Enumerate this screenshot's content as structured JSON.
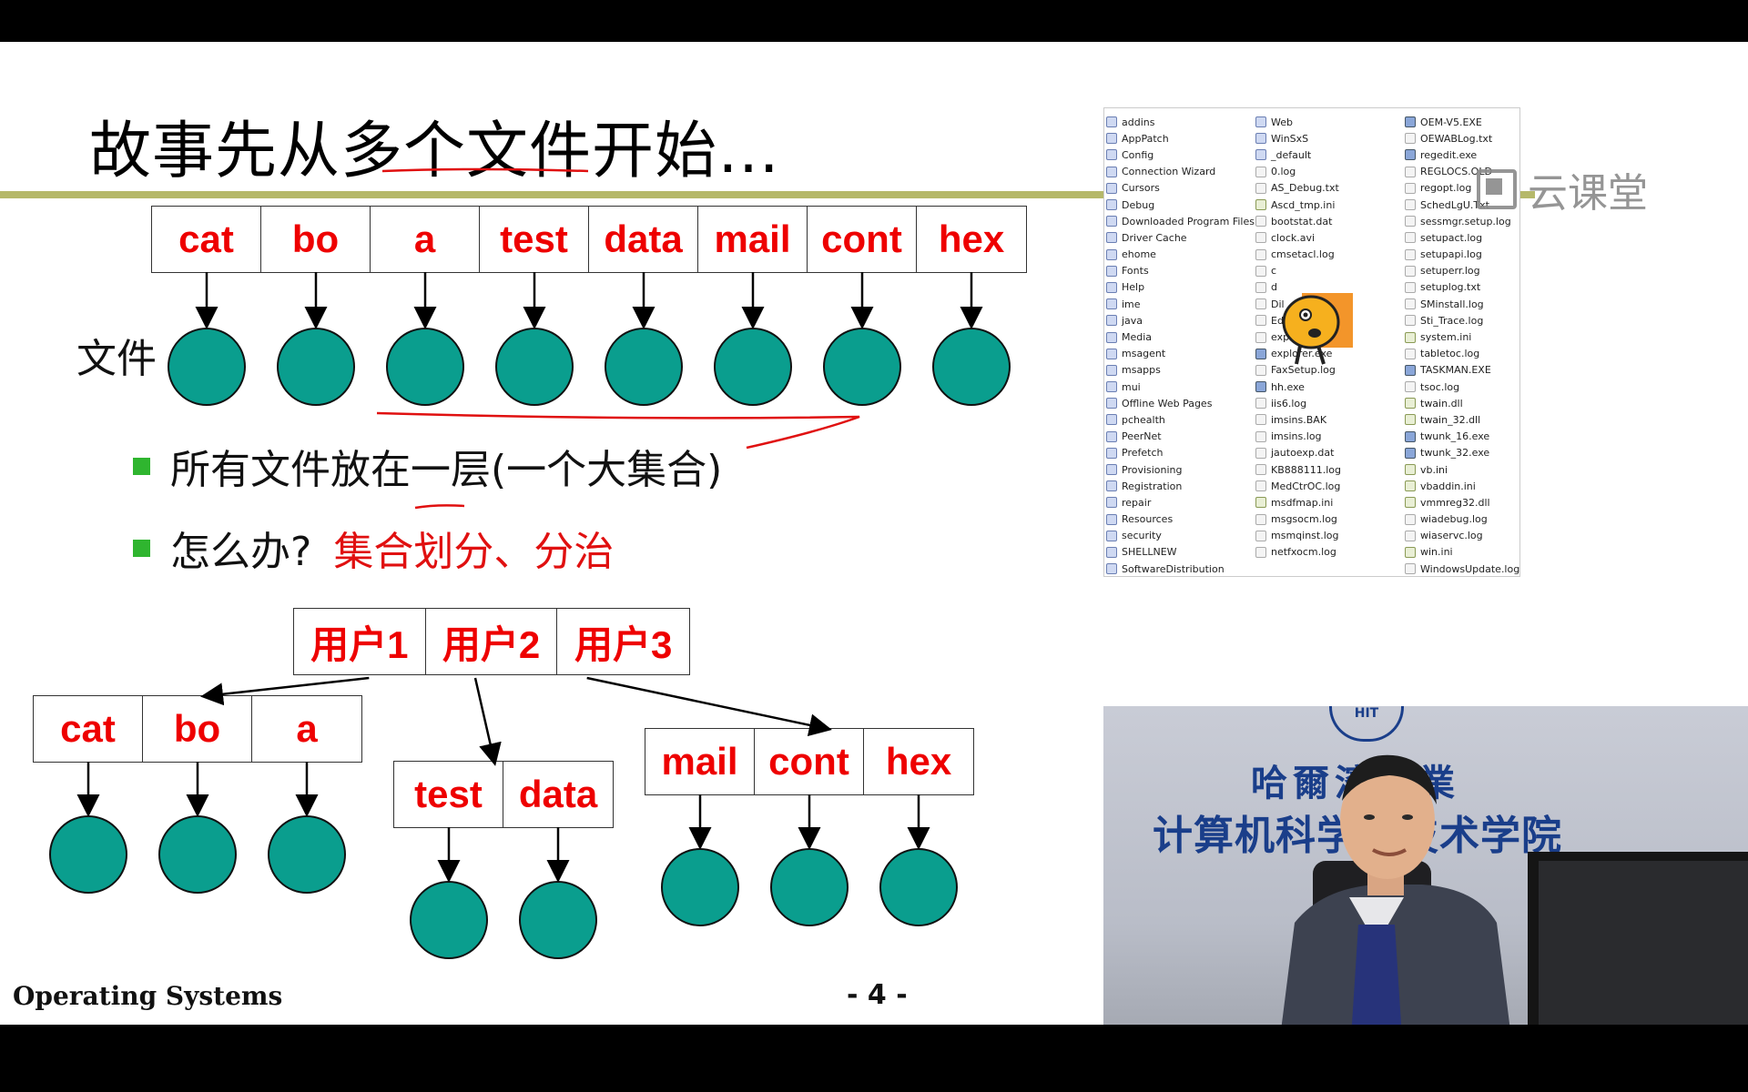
{
  "slide": {
    "title": "故事先从多个文件开始…",
    "file_label": "文件",
    "files": [
      "cat",
      "bo",
      "a",
      "test",
      "data",
      "mail",
      "cont",
      "hex"
    ],
    "bullets": [
      {
        "text": "所有文件放在一层(一个大集合)",
        "highlight": ""
      },
      {
        "text": "怎么办?",
        "highlight": "集合划分、分治"
      }
    ],
    "users": [
      "用户1",
      "用户2",
      "用户3"
    ],
    "user_groups": [
      [
        "cat",
        "bo",
        "a"
      ],
      [
        "test",
        "data"
      ],
      [
        "mail",
        "cont",
        "hex"
      ]
    ],
    "footer_left": "Operating Systems",
    "page_number": "- 4 -",
    "colors": {
      "node": "#0a9e8e",
      "file_text": "#e00000",
      "rule": "#b5b86a",
      "bullet": "#2fb52f"
    }
  },
  "explorer": {
    "col1": [
      "addins",
      "AppPatch",
      "Config",
      "Connection Wizard",
      "Cursors",
      "Debug",
      "Downloaded Program Files",
      "Driver Cache",
      "ehome",
      "Fonts",
      "Help",
      "ime",
      "java",
      "Media",
      "msagent",
      "msapps",
      "mui",
      "Offline Web Pages",
      "pchealth",
      "PeerNet",
      "Prefetch",
      "Provisioning",
      "Registration",
      "repair",
      "Resources",
      "security",
      "SHELLNEW",
      "SoftwareDistribution"
    ],
    "col2": [
      "Web",
      "WinSxS",
      "_default",
      "0.log",
      "AS_Debug.txt",
      "Ascd_tmp.ini",
      "bootstat.dat",
      "clock.avi",
      "cmsetacl.log",
      "c",
      "d",
      "Dil",
      "Edit.il",
      "explorer",
      "explorer.exe",
      "FaxSetup.log",
      "hh.exe",
      "iis6.log",
      "imsins.BAK",
      "imsins.log",
      "jautoexp.dat",
      "KB888111.log",
      "MedCtrOC.log",
      "msdfmap.ini",
      "msgsocm.log",
      "msmqinst.log",
      "netfxocm.log"
    ],
    "col3": [
      "OEM-V5.EXE",
      "OEWABLog.txt",
      "regedit.exe",
      "REGLOCS.OLD",
      "regopt.log",
      "SchedLgU.Txt",
      "sessmgr.setup.log",
      "setupact.log",
      "setupapi.log",
      "setuperr.log",
      "setuplog.txt",
      "SMinstall.log",
      "Sti_Trace.log",
      "system.ini",
      "tabletoc.log",
      "TASKMAN.EXE",
      "tsoc.log",
      "twain.dll",
      "twain_32.dll",
      "twunk_16.exe",
      "twunk_32.exe",
      "vb.ini",
      "vbaddin.ini",
      "vmmreg32.dll",
      "wiadebug.log",
      "wiaservc.log",
      "win.ini",
      "WindowsUpdate.log"
    ]
  },
  "watermark": {
    "text": "云课堂"
  },
  "video": {
    "line1": "哈爾濱工業",
    "line2": "计算机科学与技术学院",
    "logo_text": "HIT"
  }
}
